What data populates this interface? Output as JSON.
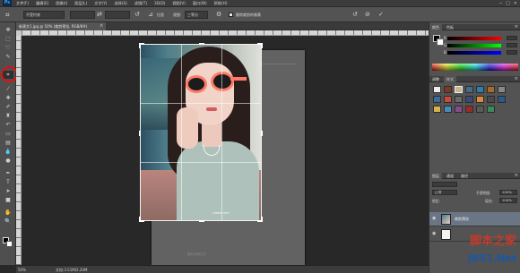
{
  "app": {
    "logo": "Ps"
  },
  "menu": [
    "文件(F)",
    "编辑(E)",
    "图像(I)",
    "图层(L)",
    "文字(Y)",
    "选择(S)",
    "滤镜(T)",
    "3D(D)",
    "视图(V)",
    "窗口(W)",
    "帮助(H)"
  ],
  "window_controls": [
    "─",
    "□",
    "✕"
  ],
  "options": {
    "ratio_value": "不受约束",
    "straighten_label": "拉直",
    "view_label": "视图:",
    "view_value": "三等分",
    "delete_cropped_label": "删除裁剪的像素",
    "delete_cropped_checked": true
  },
  "document": {
    "tab_title": "新建文1.jpg @ 50% (裁剪预览, RGB/8#)",
    "tab_close": "×",
    "header_text": "图片标题",
    "footer_text": "图片说明文字",
    "photo_caption": "LOREM TEXT"
  },
  "status": {
    "zoom": "50%",
    "doc_size": "文档:3.51M/2.20M"
  },
  "panels": {
    "color": {
      "tabs": [
        "颜色",
        "色板"
      ],
      "labels": [
        "R",
        "G",
        "B"
      ]
    },
    "styles": {
      "tabs": [
        "调整",
        "样式"
      ]
    },
    "layers": {
      "tabs": [
        "图层",
        "通道",
        "路径"
      ],
      "blend_mode": "正常",
      "opacity_label": "不透明度:",
      "opacity_value": "100%",
      "lock_label": "锁定:",
      "fill_label": "填充:",
      "fill_value": "100%",
      "items": [
        {
          "name": "裁剪预览",
          "selected": true
        },
        {
          "name": "",
          "selected": false
        }
      ]
    }
  },
  "toolbar": {
    "tools": [
      "move-tool",
      "marquee-tool",
      "lasso-tool",
      "quick-select-tool",
      "crop-tool",
      "eyedropper-tool",
      "healing-tool",
      "brush-tool",
      "stamp-tool",
      "history-brush-tool",
      "eraser-tool",
      "gradient-tool",
      "blur-tool",
      "dodge-tool",
      "pen-tool",
      "type-tool",
      "path-select-tool",
      "shape-tool",
      "hand-tool",
      "zoom-tool"
    ],
    "active_tool": "crop-tool"
  },
  "watermark": {
    "top": "脚本之家",
    "bottom": "JB51.Net"
  },
  "colors": {
    "highlight_ring": "#e01010",
    "watermark_red": "#c23b2b",
    "watermark_blue": "#1a57a8",
    "selected_layer": "#6a7685"
  }
}
